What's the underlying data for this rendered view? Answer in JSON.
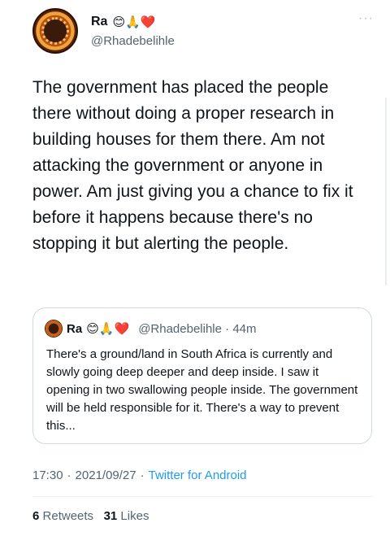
{
  "author": {
    "name": "Ra",
    "emojis": "😊🙏❤️",
    "handle": "@Rhadebelihle",
    "more_icon": "more-horizontal-icon"
  },
  "tweet": {
    "text": "The government has placed the people there without doing a proper research in building houses for them there. Am not attacking the government or anyone in power. Am just giving you a chance to fix it before it happens because there's no stopping it but alerting the people."
  },
  "quoted": {
    "name": "Ra",
    "emojis": "😊🙏❤️",
    "handle_time": "@Rhadebelihle · 44m",
    "text": "There's a ground/land in South Africa is currently and slowly going deep deeper and deep inside. I saw it opening in two swallowing people inside. The government will be held responsible for it. There's a way to prevent this..."
  },
  "meta": {
    "time": "17:30",
    "date": "2021/09/27",
    "sep": "·",
    "app": "Twitter for Android"
  },
  "stats": {
    "retweets_count": "6",
    "retweets_label": "Retweets",
    "likes_count": "31",
    "likes_label": "Likes"
  },
  "colors": {
    "link": "#1d9bf0",
    "muted": "#536471",
    "text": "#0f1419",
    "border": "#cfd9de"
  }
}
